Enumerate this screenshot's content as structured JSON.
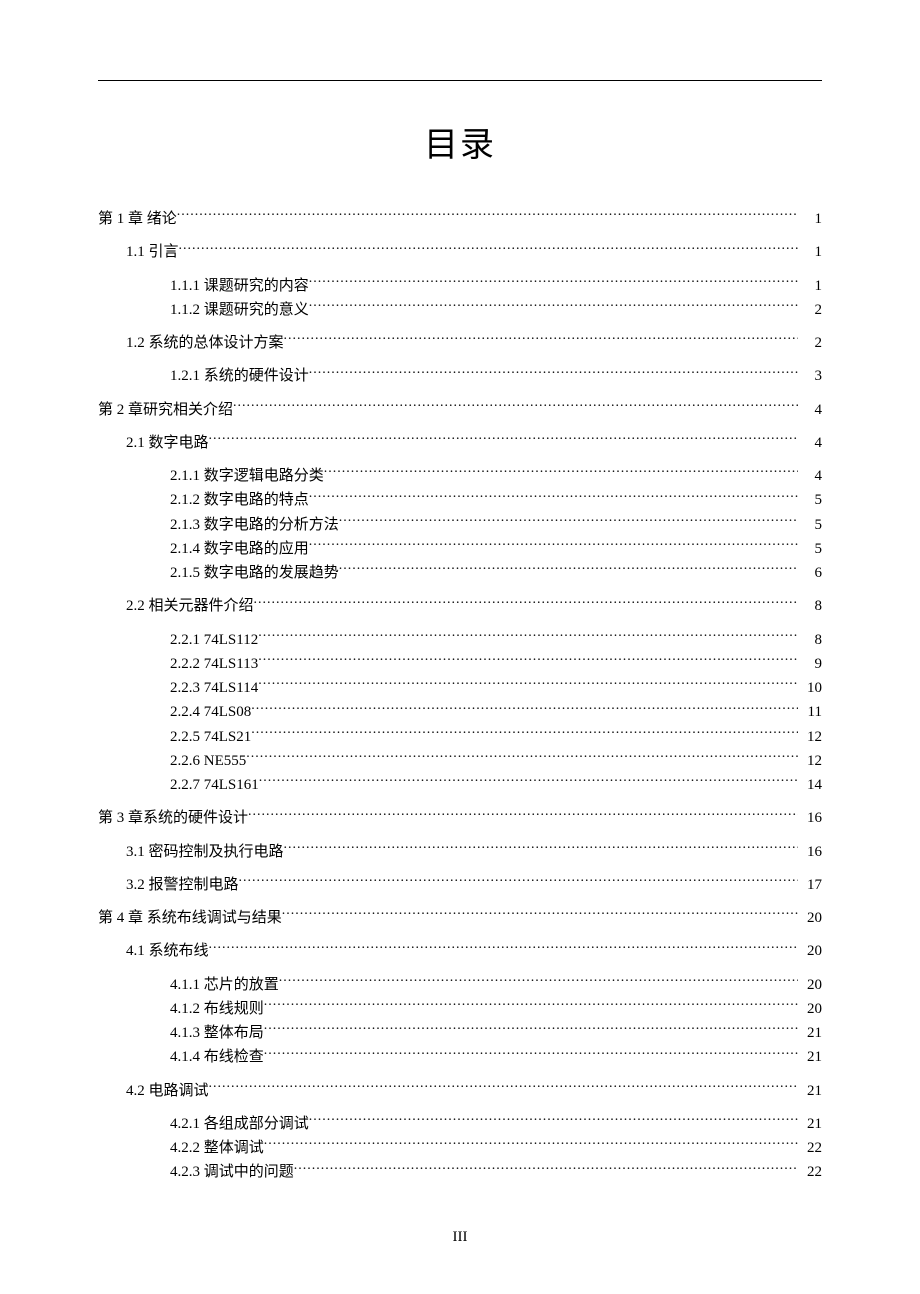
{
  "doc_title": "目录",
  "page_number": "III",
  "toc": [
    {
      "level": 0,
      "label": "第 1 章  绪论",
      "page": "1",
      "gap": false
    },
    {
      "level": 1,
      "label": "1.1  引言",
      "page": "1",
      "gap": true
    },
    {
      "level": 2,
      "label": "1.1.1 课题研究的内容",
      "page": "1",
      "gap": true
    },
    {
      "level": 2,
      "label": "1.1.2 课题研究的意义",
      "page": "2",
      "gap": false
    },
    {
      "level": 1,
      "label": "1.2 系统的总体设计方案",
      "page": "2",
      "gap": true
    },
    {
      "level": 2,
      "label": "1.2.1 系统的硬件设计",
      "page": "3",
      "gap": true
    },
    {
      "level": 0,
      "label": "第 2 章研究相关介绍",
      "page": "4",
      "gap": true
    },
    {
      "level": 1,
      "label": "2.1  数字电路",
      "page": "4",
      "gap": true
    },
    {
      "level": 2,
      "label": "2.1.1 数字逻辑电路分类",
      "page": "4",
      "gap": true
    },
    {
      "level": 2,
      "label": "2.1.2 数字电路的特点",
      "page": "5",
      "gap": false
    },
    {
      "level": 2,
      "label": "2.1.3  数字电路的分析方法",
      "page": "5",
      "gap": false
    },
    {
      "level": 2,
      "label": "2.1.4 数字电路的应用",
      "page": "5",
      "gap": false
    },
    {
      "level": 2,
      "label": "2.1.5 数字电路的发展趋势",
      "page": "6",
      "gap": false
    },
    {
      "level": 1,
      "label": "2.2  相关元器件介绍",
      "page": "8",
      "gap": true
    },
    {
      "level": 2,
      "label": "2.2.1 74LS112",
      "page": "8",
      "gap": true
    },
    {
      "level": 2,
      "label": "2.2.2 74LS113",
      "page": "9",
      "gap": false
    },
    {
      "level": 2,
      "label": "2.2.3 74LS114",
      "page": "10",
      "gap": false
    },
    {
      "level": 2,
      "label": "2.2.4 74LS08",
      "page": "11",
      "gap": false
    },
    {
      "level": 2,
      "label": "2.2.5 74LS21",
      "page": "12",
      "gap": false
    },
    {
      "level": 2,
      "label": "2.2.6 NE555",
      "page": "12",
      "gap": false
    },
    {
      "level": 2,
      "label": "2.2.7 74LS161",
      "page": "14",
      "gap": false
    },
    {
      "level": 0,
      "label": "第 3 章系统的硬件设计",
      "page": "16",
      "gap": true
    },
    {
      "level": 1,
      "label": "3.1 密码控制及执行电路",
      "page": "16",
      "gap": true
    },
    {
      "level": 1,
      "label": "3.2 报警控制电路",
      "page": "17",
      "gap": true
    },
    {
      "level": 0,
      "label": "第 4 章  系统布线调试与结果",
      "page": "20",
      "gap": true
    },
    {
      "level": 1,
      "label": "4.1  系统布线",
      "page": "20",
      "gap": true
    },
    {
      "level": 2,
      "label": "4.1.1 芯片的放置",
      "page": "20",
      "gap": true
    },
    {
      "level": 2,
      "label": "4.1.2  布线规则",
      "page": "20",
      "gap": false
    },
    {
      "level": 2,
      "label": "4.1.3  整体布局",
      "page": "21",
      "gap": false
    },
    {
      "level": 2,
      "label": "4.1.4  布线检查",
      "page": "21",
      "gap": false
    },
    {
      "level": 1,
      "label": "4.2  电路调试",
      "page": "21",
      "gap": true
    },
    {
      "level": 2,
      "label": "4.2.1  各组成部分调试",
      "page": "21",
      "gap": true
    },
    {
      "level": 2,
      "label": "4.2.2  整体调试",
      "page": "22",
      "gap": false
    },
    {
      "level": 2,
      "label": "4.2.3 调试中的问题",
      "page": "22",
      "gap": false
    }
  ]
}
